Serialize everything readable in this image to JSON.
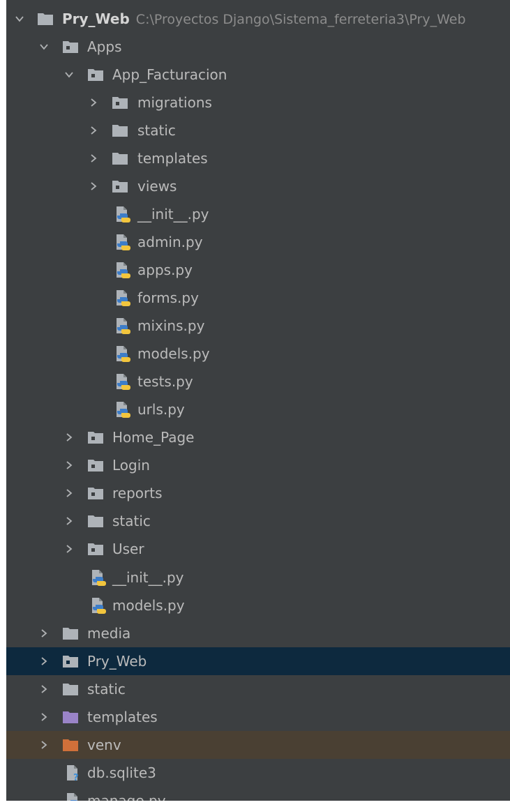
{
  "colors": {
    "panel_bg": "#3c3f41",
    "text": "#bbbbbb",
    "selected_row_bg": "#0d293e",
    "excluded_row_bg": "#4a4033",
    "folder": "#aeb3b8",
    "folder_purple": "#9a84c8",
    "folder_orange": "#d0703a"
  },
  "tree": {
    "root": {
      "name": "Pry_Web",
      "path": "C:\\Proyectos Django\\Sistema_ferreteria3\\Pry_Web",
      "icon": "folder-icon"
    },
    "apps": {
      "name": "Apps",
      "icon": "package-folder-icon"
    },
    "app_facturacion": {
      "name": "App_Facturacion",
      "icon": "package-folder-icon",
      "folders": [
        {
          "name": "migrations",
          "icon": "package-folder-icon"
        },
        {
          "name": "static",
          "icon": "folder-icon"
        },
        {
          "name": "templates",
          "icon": "folder-icon"
        },
        {
          "name": "views",
          "icon": "package-folder-icon"
        }
      ],
      "files": [
        {
          "name": "__init__.py",
          "icon": "python-file-icon"
        },
        {
          "name": "admin.py",
          "icon": "python-file-icon"
        },
        {
          "name": "apps.py",
          "icon": "python-file-icon"
        },
        {
          "name": "forms.py",
          "icon": "python-file-icon"
        },
        {
          "name": "mixins.py",
          "icon": "python-file-icon"
        },
        {
          "name": "models.py",
          "icon": "python-file-icon"
        },
        {
          "name": "tests.py",
          "icon": "python-file-icon"
        },
        {
          "name": "urls.py",
          "icon": "python-file-icon"
        }
      ]
    },
    "apps_children": [
      {
        "name": "Home_Page",
        "icon": "package-folder-icon"
      },
      {
        "name": "Login",
        "icon": "package-folder-icon"
      },
      {
        "name": "reports",
        "icon": "package-folder-icon"
      },
      {
        "name": "static",
        "icon": "folder-icon"
      },
      {
        "name": "User",
        "icon": "package-folder-icon"
      }
    ],
    "apps_files": [
      {
        "name": "__init__.py",
        "icon": "python-file-icon"
      },
      {
        "name": "models.py",
        "icon": "python-file-icon"
      }
    ],
    "root_children": [
      {
        "name": "media",
        "icon": "folder-icon"
      },
      {
        "name": "Pry_Web",
        "icon": "package-folder-icon",
        "selected": true
      },
      {
        "name": "static",
        "icon": "folder-icon"
      },
      {
        "name": "templates",
        "icon": "templates-folder-icon"
      },
      {
        "name": "venv",
        "icon": "excluded-folder-icon"
      }
    ],
    "root_files": [
      {
        "name": "db.sqlite3",
        "icon": "unknown-file-icon"
      },
      {
        "name": "manage.py",
        "icon": "python-file-icon"
      }
    ]
  }
}
